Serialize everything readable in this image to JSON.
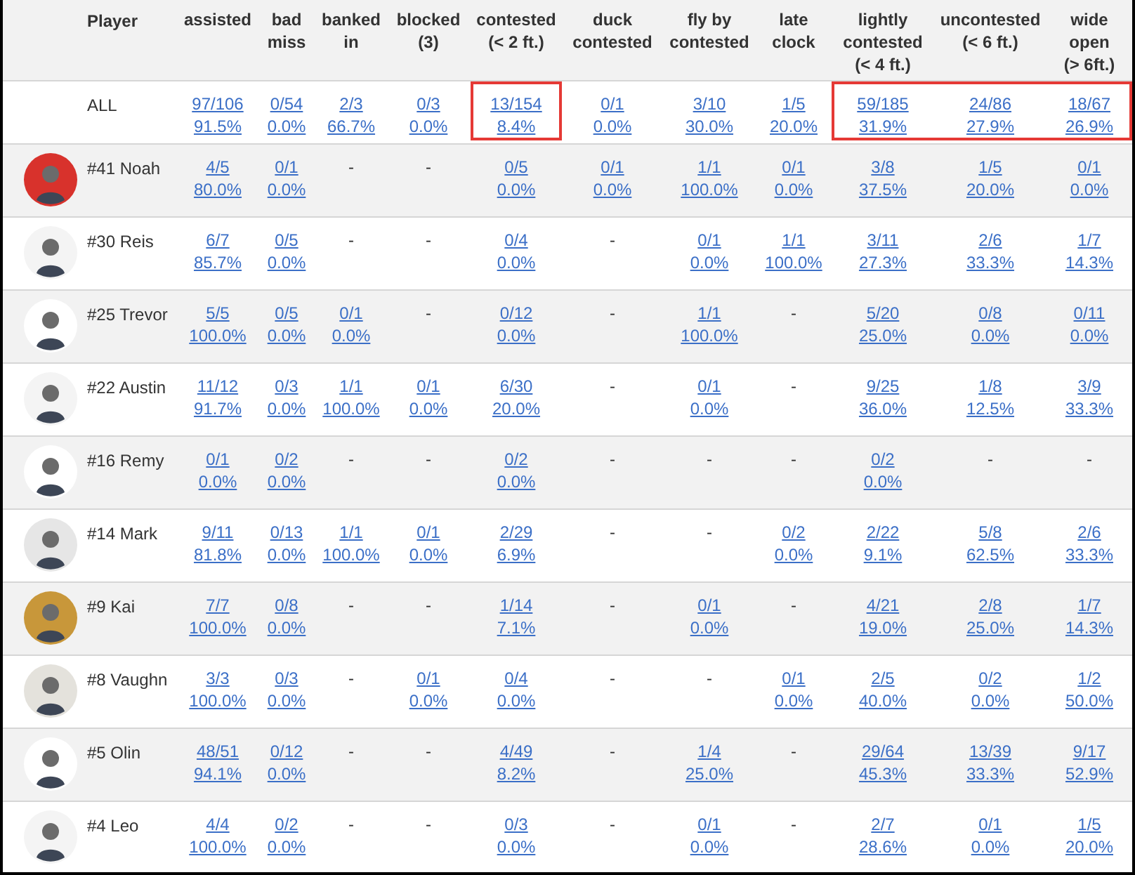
{
  "table": {
    "columns": [
      {
        "label": "Player",
        "kind": "player"
      },
      {
        "label": [
          "assisted"
        ],
        "kind": "stat"
      },
      {
        "label": [
          "bad",
          "miss"
        ],
        "kind": "stat"
      },
      {
        "label": [
          "banked",
          "in"
        ],
        "kind": "stat"
      },
      {
        "label": [
          "blocked",
          "(3)"
        ],
        "kind": "stat"
      },
      {
        "label": [
          "contested",
          "(< 2 ft.)"
        ],
        "kind": "stat"
      },
      {
        "label": [
          "duck",
          "contested"
        ],
        "kind": "stat"
      },
      {
        "label": [
          "fly by",
          "contested"
        ],
        "kind": "stat"
      },
      {
        "label": [
          "late",
          "clock"
        ],
        "kind": "stat"
      },
      {
        "label": [
          "lightly",
          "contested",
          "(< 4 ft.)"
        ],
        "kind": "stat"
      },
      {
        "label": [
          "uncontested",
          "(< 6 ft.)"
        ],
        "kind": "stat"
      },
      {
        "label": [
          "wide",
          "open",
          "(> 6ft.)"
        ],
        "kind": "stat"
      }
    ],
    "rows": [
      {
        "highlighted": [
          false,
          false,
          false,
          false,
          false,
          true,
          false,
          false,
          false,
          true,
          true,
          true
        ],
        "cells": [
          "ALL",
          [
            "97/106",
            "91.5%"
          ],
          [
            "0/54",
            "0.0%"
          ],
          [
            "2/3",
            "66.7%"
          ],
          [
            "0/3",
            "0.0%"
          ],
          [
            "13/154",
            "8.4%"
          ],
          [
            "0/1",
            "0.0%"
          ],
          [
            "3/10",
            "30.0%"
          ],
          [
            "1/5",
            "20.0%"
          ],
          [
            "59/185",
            "31.9%"
          ],
          [
            "24/86",
            "27.9%"
          ],
          [
            "18/67",
            "26.9%"
          ]
        ]
      },
      {
        "color": "#d8322c",
        "cells": [
          "#41 Noah",
          [
            "4/5",
            "80.0%"
          ],
          [
            "0/1",
            "0.0%"
          ],
          "-",
          "-",
          [
            "0/5",
            "0.0%"
          ],
          [
            "0/1",
            "0.0%"
          ],
          [
            "1/1",
            "100.0%"
          ],
          [
            "0/1",
            "0.0%"
          ],
          [
            "3/8",
            "37.5%"
          ],
          [
            "1/5",
            "20.0%"
          ],
          [
            "0/1",
            "0.0%"
          ]
        ]
      },
      {
        "color": "#f4f4f4",
        "cells": [
          "#30 Reis",
          [
            "6/7",
            "85.7%"
          ],
          [
            "0/5",
            "0.0%"
          ],
          "-",
          "-",
          [
            "0/4",
            "0.0%"
          ],
          "-",
          [
            "0/1",
            "0.0%"
          ],
          [
            "1/1",
            "100.0%"
          ],
          [
            "3/11",
            "27.3%"
          ],
          [
            "2/6",
            "33.3%"
          ],
          [
            "1/7",
            "14.3%"
          ]
        ]
      },
      {
        "color": "#ffffff",
        "cells": [
          "#25 Trevor",
          [
            "5/5",
            "100.0%"
          ],
          [
            "0/5",
            "0.0%"
          ],
          [
            "0/1",
            "0.0%"
          ],
          "-",
          [
            "0/12",
            "0.0%"
          ],
          "-",
          [
            "1/1",
            "100.0%"
          ],
          "-",
          [
            "5/20",
            "25.0%"
          ],
          [
            "0/8",
            "0.0%"
          ],
          [
            "0/11",
            "0.0%"
          ]
        ]
      },
      {
        "color": "#f4f4f4",
        "cells": [
          "#22 Austin",
          [
            "11/12",
            "91.7%"
          ],
          [
            "0/3",
            "0.0%"
          ],
          [
            "1/1",
            "100.0%"
          ],
          [
            "0/1",
            "0.0%"
          ],
          [
            "6/30",
            "20.0%"
          ],
          "-",
          [
            "0/1",
            "0.0%"
          ],
          "-",
          [
            "9/25",
            "36.0%"
          ],
          [
            "1/8",
            "12.5%"
          ],
          [
            "3/9",
            "33.3%"
          ]
        ]
      },
      {
        "color": "#ffffff",
        "cells": [
          "#16 Remy",
          [
            "0/1",
            "0.0%"
          ],
          [
            "0/2",
            "0.0%"
          ],
          "-",
          "-",
          [
            "0/2",
            "0.0%"
          ],
          "-",
          "-",
          "-",
          [
            "0/2",
            "0.0%"
          ],
          "-",
          "-"
        ]
      },
      {
        "color": "#e6e6e6",
        "cells": [
          "#14 Mark",
          [
            "9/11",
            "81.8%"
          ],
          [
            "0/13",
            "0.0%"
          ],
          [
            "1/1",
            "100.0%"
          ],
          [
            "0/1",
            "0.0%"
          ],
          [
            "2/29",
            "6.9%"
          ],
          "-",
          "-",
          [
            "0/2",
            "0.0%"
          ],
          [
            "2/22",
            "9.1%"
          ],
          [
            "5/8",
            "62.5%"
          ],
          [
            "2/6",
            "33.3%"
          ]
        ]
      },
      {
        "color": "#c8973a",
        "cells": [
          "#9 Kai",
          [
            "7/7",
            "100.0%"
          ],
          [
            "0/8",
            "0.0%"
          ],
          "-",
          "-",
          [
            "1/14",
            "7.1%"
          ],
          "-",
          [
            "0/1",
            "0.0%"
          ],
          "-",
          [
            "4/21",
            "19.0%"
          ],
          [
            "2/8",
            "25.0%"
          ],
          [
            "1/7",
            "14.3%"
          ]
        ]
      },
      {
        "color": "#e4e2dc",
        "cells": [
          "#8 Vaughn",
          [
            "3/3",
            "100.0%"
          ],
          [
            "0/3",
            "0.0%"
          ],
          "-",
          [
            "0/1",
            "0.0%"
          ],
          [
            "0/4",
            "0.0%"
          ],
          "-",
          "-",
          [
            "0/1",
            "0.0%"
          ],
          [
            "2/5",
            "40.0%"
          ],
          [
            "0/2",
            "0.0%"
          ],
          [
            "1/2",
            "50.0%"
          ]
        ]
      },
      {
        "color": "#ffffff",
        "cells": [
          "#5 Olin",
          [
            "48/51",
            "94.1%"
          ],
          [
            "0/12",
            "0.0%"
          ],
          "-",
          "-",
          [
            "4/49",
            "8.2%"
          ],
          "-",
          [
            "1/4",
            "25.0%"
          ],
          "-",
          [
            "29/64",
            "45.3%"
          ],
          [
            "13/39",
            "33.3%"
          ],
          [
            "9/17",
            "52.9%"
          ]
        ]
      },
      {
        "color": "#f4f4f4",
        "cells": [
          "#4 Leo",
          [
            "4/4",
            "100.0%"
          ],
          [
            "0/2",
            "0.0%"
          ],
          "-",
          "-",
          [
            "0/3",
            "0.0%"
          ],
          "-",
          [
            "0/1",
            "0.0%"
          ],
          "-",
          [
            "2/7",
            "28.6%"
          ],
          [
            "0/1",
            "0.0%"
          ],
          [
            "1/5",
            "20.0%"
          ]
        ]
      }
    ]
  }
}
